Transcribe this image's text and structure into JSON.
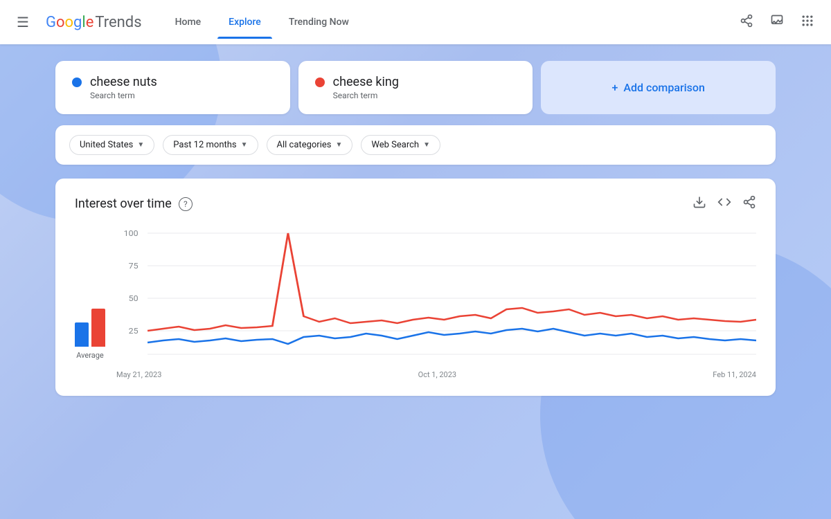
{
  "header": {
    "menu_icon": "☰",
    "logo_google": "Google",
    "logo_trends": "Trends",
    "nav": [
      {
        "id": "home",
        "label": "Home",
        "active": false
      },
      {
        "id": "explore",
        "label": "Explore",
        "active": true
      },
      {
        "id": "trending",
        "label": "Trending Now",
        "active": false
      }
    ],
    "share_icon": "⬆",
    "feedback_icon": "⚑",
    "apps_icon": "⠿"
  },
  "search_terms": [
    {
      "id": "term1",
      "name": "cheese nuts",
      "type": "Search term",
      "dot_color": "blue"
    },
    {
      "id": "term2",
      "name": "cheese king",
      "type": "Search term",
      "dot_color": "red"
    }
  ],
  "add_comparison": {
    "label": "Add comparison",
    "icon": "+"
  },
  "filters": [
    {
      "id": "location",
      "label": "United States"
    },
    {
      "id": "time",
      "label": "Past 12 months"
    },
    {
      "id": "category",
      "label": "All categories"
    },
    {
      "id": "search_type",
      "label": "Web Search"
    }
  ],
  "chart": {
    "title": "Interest over time",
    "help_symbol": "?",
    "download_icon": "↓",
    "embed_icon": "<>",
    "share_icon": "⬆",
    "y_axis": [
      "100",
      "75",
      "50",
      "25"
    ],
    "x_axis": [
      "May 21, 2023",
      "Oct 1, 2023",
      "Feb 11, 2024"
    ],
    "legend_label": "Average"
  }
}
